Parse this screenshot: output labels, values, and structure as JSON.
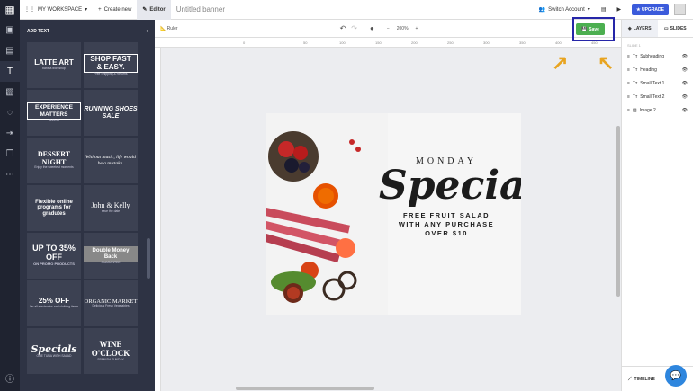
{
  "topbar": {
    "workspace": "MY WORKSPACE",
    "create_new": "Create new",
    "editor": "Editor",
    "doc_title": "Untitled banner",
    "switch_account": "Switch Account",
    "upgrade": "UPGRADE"
  },
  "panel": {
    "title": "ADD TEXT",
    "cards": [
      {
        "big": "LATTE ART",
        "small": "barista workshop"
      },
      {
        "big": "SHOP FAST & EASY.",
        "small": "Free Shipping & Returns"
      },
      {
        "big": "EXPERIENCE MATTERS",
        "small": "$125.00"
      },
      {
        "big": "RUNNING SHOES SALE",
        "small": ""
      },
      {
        "big": "DESSERT NIGHT",
        "small": "Enjoy the sweetest moments"
      },
      {
        "big": "Without music, life would be a mistake.",
        "small": ""
      },
      {
        "big": "Flexible online programs for gradutes",
        "small": ""
      },
      {
        "big": "John & Kelly",
        "small": "save the date"
      },
      {
        "big": "UP TO 35% OFF",
        "small": "ON PROMO PRODUCTS"
      },
      {
        "big": "Double Money Back",
        "small": "GUARANTEE"
      },
      {
        "big": "25% OFF",
        "small": "On all electronics and clothing items"
      },
      {
        "big": "ORGANIC MARKET",
        "small": "Delicious Fresh Vegetables"
      },
      {
        "big": "Specials",
        "small": "ONE TUNA WITH SALAD"
      },
      {
        "big": "WINE O'CLOCK",
        "small": "SPANISH SUNDAY"
      }
    ]
  },
  "canvas_toolbar": {
    "ruler_label": "Ruler",
    "zoom": "200%",
    "save": "Save"
  },
  "ruler_ticks": [
    "0",
    "50",
    "100",
    "150",
    "200",
    "250",
    "300",
    "350",
    "400",
    "450"
  ],
  "banner": {
    "monday": "MONDAY",
    "special": "Special",
    "line1": "FREE FRUIT SALAD",
    "line2": "WITH ANY PURCHASE",
    "line3": "OVER $10"
  },
  "right_panel": {
    "tab_layers": "LAYERS",
    "tab_slides": "SLIDES",
    "slide_label": "SLIDE 1",
    "layers": [
      "Subheading",
      "Heading",
      "Small Text 1",
      "Small Text 2",
      "Image 2"
    ],
    "timeline": "TIMELINE"
  },
  "colors": {
    "accent": "#3b5bdb",
    "save_green": "#4caf50",
    "highlight_box": "#2626a8",
    "arrow": "#e8a420"
  }
}
